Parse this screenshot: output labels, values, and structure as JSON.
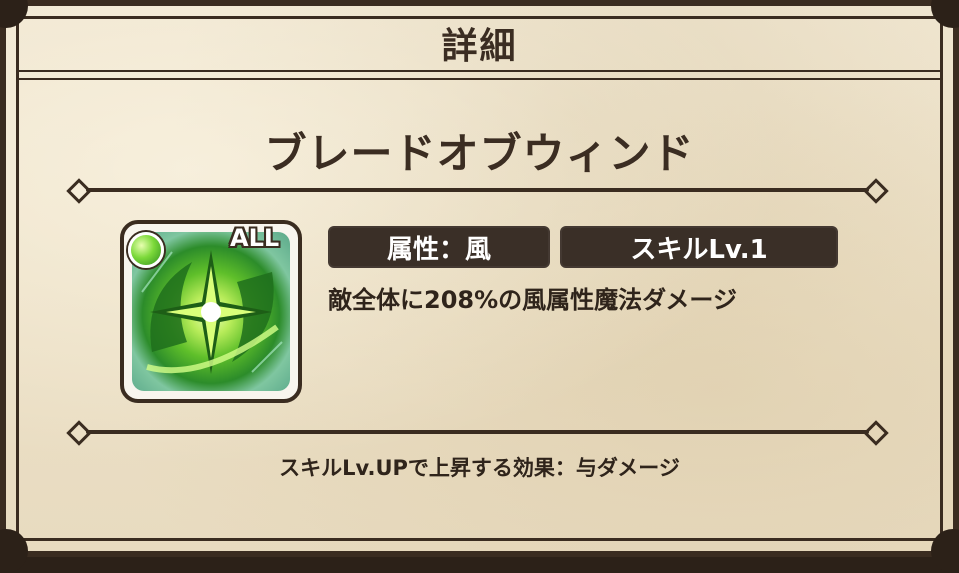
{
  "header": {
    "title": "詳細"
  },
  "skill": {
    "name": "ブレードオブウィンド",
    "badge": "ALL",
    "attribute_label": "属性：風",
    "level_label": "スキルLv.1",
    "description": "敵全体に208%の風属性魔法ダメージ",
    "icon": "wind-star-slash-icon"
  },
  "footer": {
    "text": "スキルLv.UPで上昇する効果：与ダメージ"
  },
  "colors": {
    "frame": "#3a2c20",
    "parchment": "#ece0c6",
    "pill": "#3a2f27",
    "text": "#2f241b",
    "wind_green": "#5fbf2a"
  }
}
